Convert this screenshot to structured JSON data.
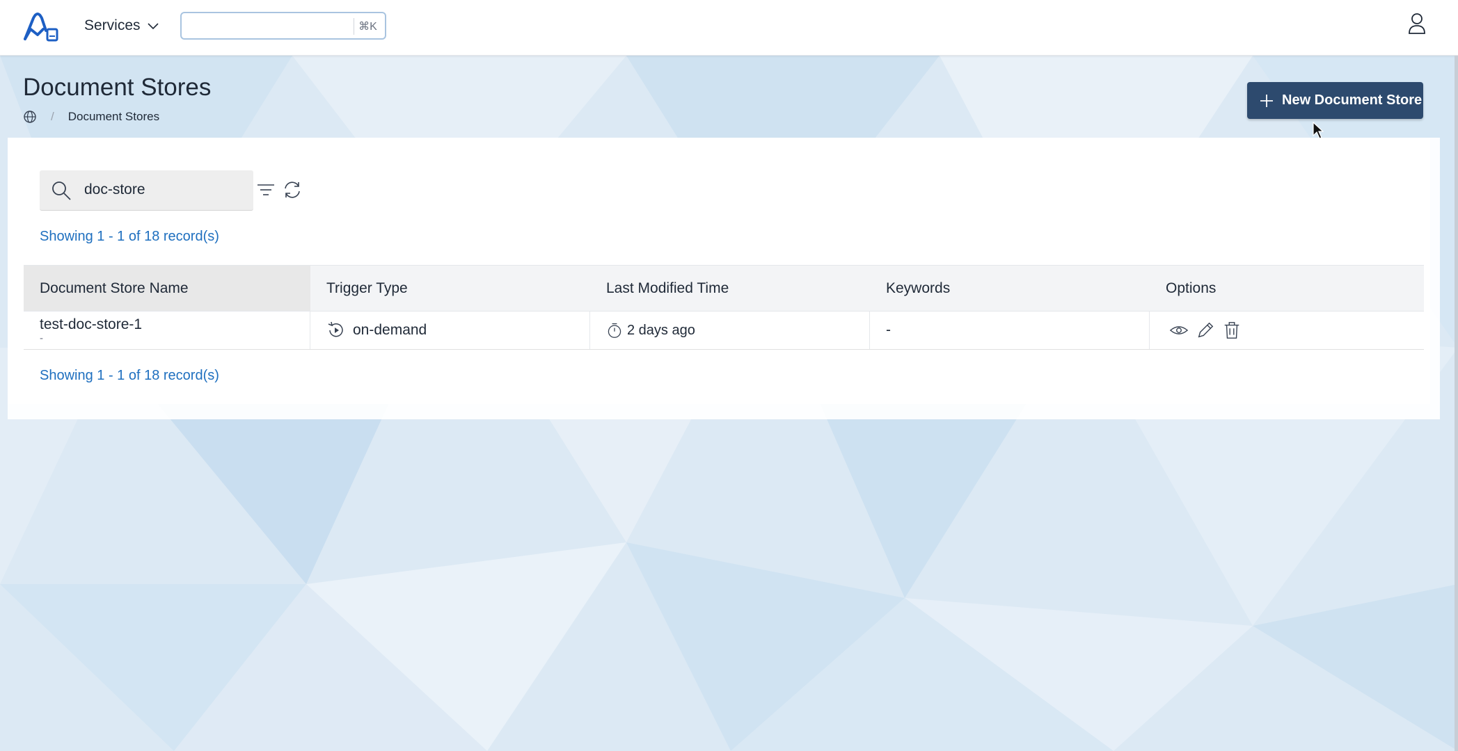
{
  "app": {
    "logo_icon": "brand-logo-icon"
  },
  "topbar": {
    "services_label": "Services",
    "search_placeholder": "",
    "search_shortcut": "⌘K"
  },
  "page": {
    "title": "Document Stores",
    "breadcrumb": {
      "home_icon": "globe-icon",
      "current": "Document Stores"
    },
    "new_button_label": "New Document Store"
  },
  "toolbar": {
    "search_value": "doc-store",
    "records_summary_top": "Showing 1 - 1 of 18 record(s)",
    "records_summary_bottom": "Showing 1 - 1 of 18 record(s)"
  },
  "table": {
    "columns": [
      "Document Store Name",
      "Trigger Type",
      "Last Modified Time",
      "Keywords",
      "Options"
    ],
    "rows": [
      {
        "name": "test-doc-store-1",
        "description": "-",
        "trigger_type": "on-demand",
        "last_modified": "2 days ago",
        "keywords": "-"
      }
    ]
  },
  "colors": {
    "primary_button": "#2d4a6e",
    "link": "#1e6fbf"
  }
}
